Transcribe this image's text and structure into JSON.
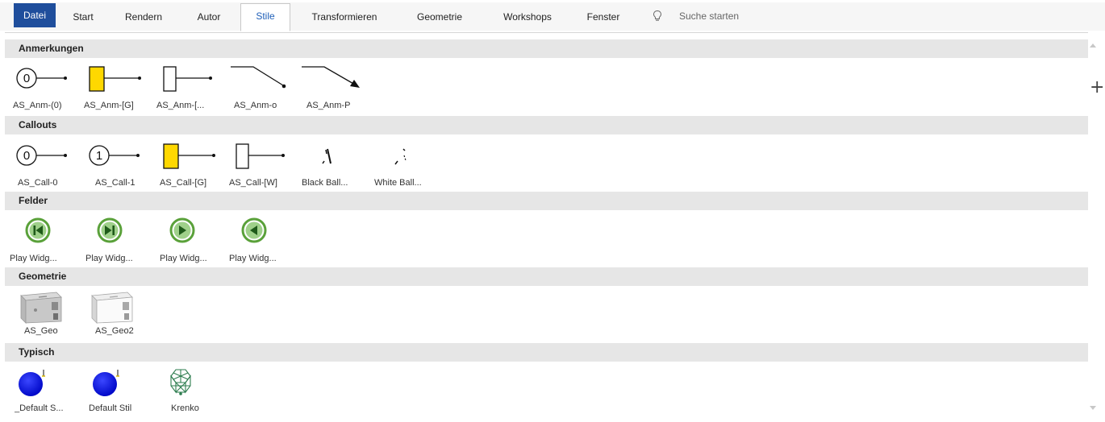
{
  "ribbon": {
    "tabs": [
      "Datei",
      "Start",
      "Rendern",
      "Autor",
      "Stile",
      "Transformieren",
      "Geometrie",
      "Workshops",
      "Fenster"
    ],
    "active_tab": "Stile",
    "search_placeholder": "Suche starten"
  },
  "panel": {
    "add_icon": "+",
    "sections": [
      {
        "title": "Anmerkungen",
        "items": [
          {
            "label": "AS_Anm-(0)",
            "icon": "circle-zero-leader-icon"
          },
          {
            "label": "AS_Anm-[G]",
            "icon": "yellow-box-leader-icon"
          },
          {
            "label": "AS_Anm-[...",
            "icon": "white-box-leader-icon"
          },
          {
            "label": "AS_Anm-o",
            "icon": "dot-leader-icon"
          },
          {
            "label": "AS_Anm-P",
            "icon": "arrow-leader-icon"
          }
        ]
      },
      {
        "title": "Callouts",
        "items": [
          {
            "label": "AS_Call-0",
            "icon": "circle-zero-leader-icon"
          },
          {
            "label": "AS_Call-1",
            "icon": "circle-one-leader-icon"
          },
          {
            "label": "AS_Call-[G]",
            "icon": "yellow-box-leader-icon"
          },
          {
            "label": "AS_Call-[W]",
            "icon": "white-box-leader-icon"
          },
          {
            "label": "Black Ball...",
            "icon": "black-ball-icon"
          },
          {
            "label": "White Ball...",
            "icon": "white-ball-icon"
          }
        ]
      },
      {
        "title": "Felder",
        "items": [
          {
            "label": "Play Widg...",
            "icon": "play-first-icon"
          },
          {
            "label": "Play Widg...",
            "icon": "play-last-icon"
          },
          {
            "label": "Play Widg...",
            "icon": "play-forward-icon"
          },
          {
            "label": "Play Widg...",
            "icon": "play-backward-icon"
          }
        ]
      },
      {
        "title": "Geometrie",
        "items": [
          {
            "label": "AS_Geo",
            "icon": "geometry-part-icon"
          },
          {
            "label": "AS_Geo2",
            "icon": "geometry-part-light-icon"
          }
        ]
      },
      {
        "title": "Typisch",
        "items": [
          {
            "label": "_Default S...",
            "icon": "blue-sphere-icon"
          },
          {
            "label": "Default Stil",
            "icon": "blue-sphere-icon"
          },
          {
            "label": "Krenko",
            "icon": "wire-cube-icon"
          }
        ]
      }
    ]
  },
  "colors": {
    "file_tab": "#1f4e9c",
    "active_tab_text": "#1f5fb8",
    "section_header": "#e6e6e6",
    "callout_yellow": "#ffd800",
    "play_green": "#5aa13a",
    "sphere_blue": "#0a14e6",
    "wire_green": "#2e7d4f"
  }
}
